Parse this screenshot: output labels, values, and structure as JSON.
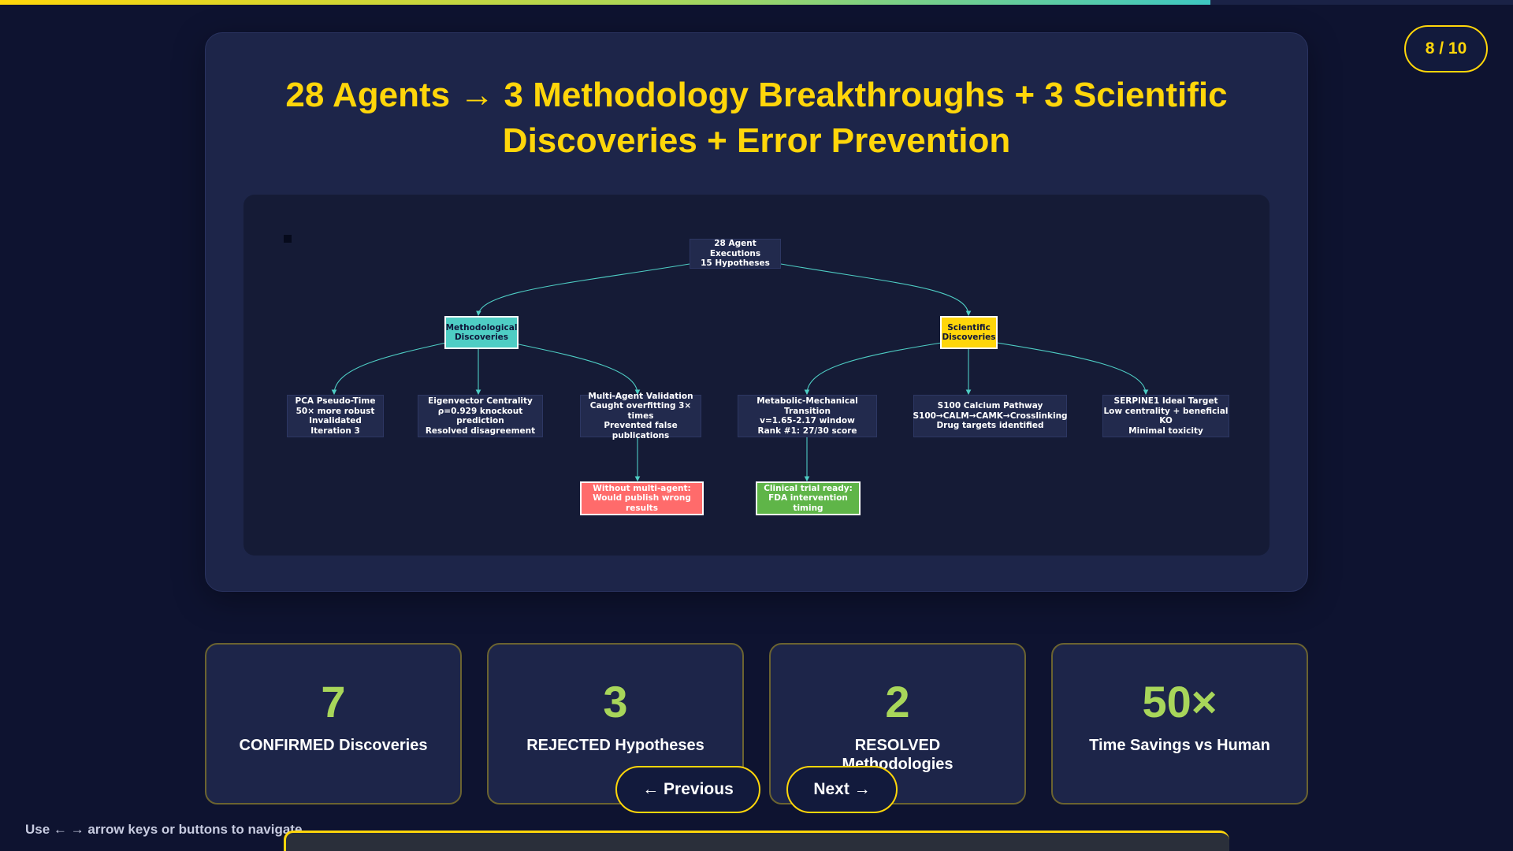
{
  "progress": {
    "fraction": 0.8
  },
  "page_counter": "8 / 10",
  "slide": {
    "title": "28 Agents → 3 Methodology Breakthroughs + 3 Scientific Discoveries + Error Prevention"
  },
  "diagram": {
    "nodes": {
      "root": "28 Agent Executions\n15 Hypotheses",
      "methodological": "Methodological\nDiscoveries",
      "scientific": "Scientific\nDiscoveries",
      "pca": "PCA Pseudo-Time\n50× more robust\nInvalidated Iteration 3",
      "eigen": "Eigenvector Centrality\nρ=0.929 knockout prediction\nResolved disagreement",
      "multiagent": "Multi-Agent Validation\nCaught overfitting 3× times\nPrevented false publications",
      "metabolic": "Metabolic-Mechanical Transition\nv=1.65-2.17 window\nRank #1: 27/30 score",
      "s100": "S100 Calcium Pathway\nS100→CALM→CAMK→Crosslinking\nDrug targets identified",
      "serpine": "SERPINE1 Ideal Target\nLow centrality + beneficial KO\nMinimal toxicity",
      "without": "Without multi-agent:\nWould publish wrong results",
      "clinical": "Clinical trial ready:\nFDA intervention timing"
    },
    "colors": {
      "edge": "#4ecdc4",
      "teal": "#4ecdc4",
      "yellow": "#ffd60a",
      "red": "#ff6b6b",
      "green": "#5fb548"
    }
  },
  "stats": [
    {
      "value": "7",
      "label": "CONFIRMED Discoveries"
    },
    {
      "value": "3",
      "label": "REJECTED Hypotheses"
    },
    {
      "value": "2",
      "label": "RESOLVED Methodologies"
    },
    {
      "value": "50×",
      "label": "Time Savings vs Human"
    }
  ],
  "nav": {
    "previous": "← Previous",
    "next": "Next →",
    "hint": "Use ← → arrow keys or buttons to navigate"
  },
  "theme": {
    "accent": "#ffd60a",
    "stat_value": "#a8d65a",
    "background": "#0e1330",
    "card": "#1d2549"
  }
}
